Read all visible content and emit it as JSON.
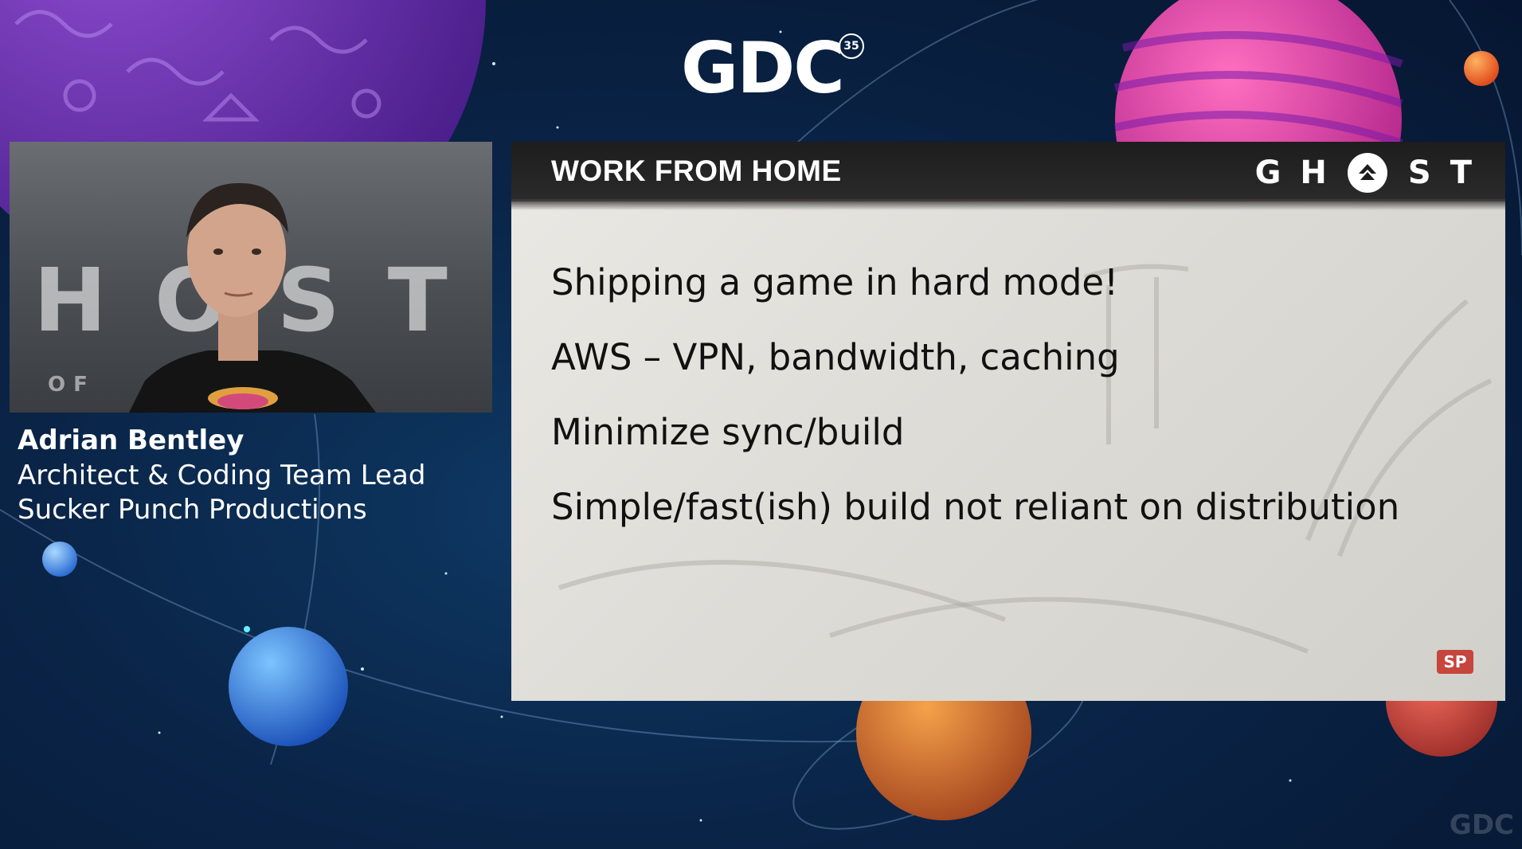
{
  "conference": {
    "logo_text": "GDC",
    "badge": "35"
  },
  "speaker": {
    "name": "Adrian Bentley",
    "title": "Architect & Coding Team Lead",
    "company": "Sucker Punch Productions"
  },
  "video": {
    "backdrop_text": "HOST",
    "backdrop_sub": "OF"
  },
  "slide": {
    "title": "WORK FROM HOME",
    "logo_left": "GH",
    "logo_right": "ST",
    "bullets": [
      "Shipping a game in hard mode!",
      "AWS – VPN, bandwidth, caching",
      "Minimize sync/build",
      "Simple/fast(ish) build not reliant on distribution"
    ],
    "corner_badge": "SP"
  },
  "watermark": "GDC",
  "colors": {
    "background": "#0a2447",
    "slide_bg": "#e3e1dc",
    "slide_header": "#222222",
    "accent_red": "#7a1b1b",
    "text_white": "#ffffff"
  }
}
